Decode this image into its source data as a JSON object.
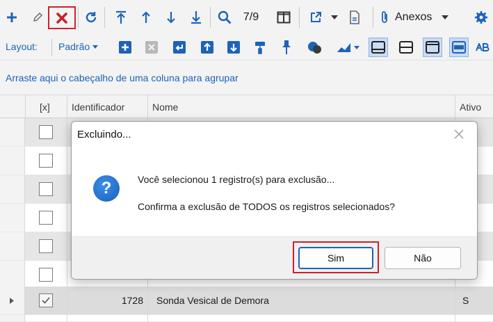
{
  "toolbar": {
    "page_counter": "7/9",
    "attachments_label": "Anexos"
  },
  "layout_bar": {
    "label": "Layout:",
    "preset": "Padrão"
  },
  "group_panel": {
    "hint": "Arraste aqui o cabeçalho de uma coluna para agrupar"
  },
  "grid": {
    "columns": [
      "[x]",
      "Identificador",
      "Nome",
      "Ativo"
    ],
    "visible_row": {
      "id": "1728",
      "name": "Sonda Vesical de Demora",
      "active": "S"
    }
  },
  "dialog": {
    "title": "Excluindo...",
    "message_line1": "Você selecionou 1 registro(s) para exclusão...",
    "message_line2": "Confirma a exclusão de TODOS os registros selecionados?",
    "yes_label": "Sim",
    "no_label": "Não"
  },
  "colors": {
    "accent": "#1d63b8",
    "highlight": "#d0202a"
  }
}
